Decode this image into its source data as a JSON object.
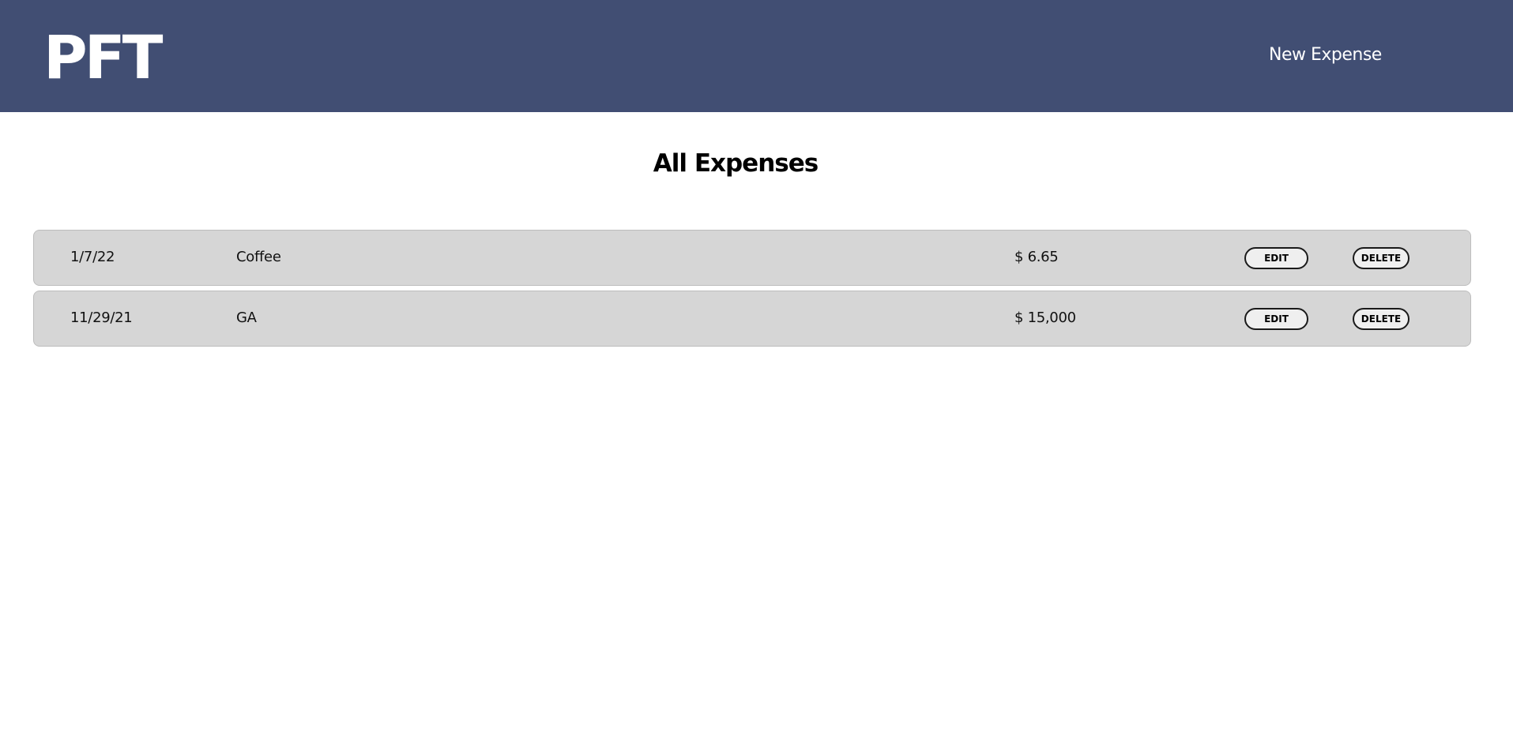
{
  "header": {
    "logo": "PFT",
    "nav_new_expense": "New Expense",
    "background_color": "#414e73"
  },
  "main": {
    "title": "All Expenses",
    "expenses": [
      {
        "date": "1/7/22",
        "description": "Coffee",
        "amount": "$ 6.65",
        "edit_label": "EDIT",
        "delete_label": "DELETE"
      },
      {
        "date": "11/29/21",
        "description": "GA",
        "amount": "$ 15,000",
        "edit_label": "EDIT",
        "delete_label": "DELETE"
      }
    ]
  }
}
